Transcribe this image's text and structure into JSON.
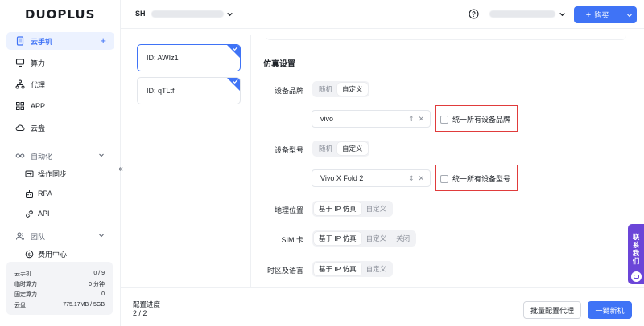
{
  "brand": {
    "logo_text": "DUOPLUS",
    "accent": "#3f73f6",
    "highlight_red": "#e03b3b",
    "contact_purple": "#6b45d8"
  },
  "sidebar": {
    "top_items": [
      {
        "label": "云手机",
        "icon": "phone-icon",
        "active": true
      },
      {
        "label": "算力",
        "icon": "monitor-icon"
      },
      {
        "label": "代理",
        "icon": "network-icon"
      },
      {
        "label": "APP",
        "icon": "apps-grid-icon"
      },
      {
        "label": "云盘",
        "icon": "cloud-icon"
      }
    ],
    "automation": {
      "label": "自动化",
      "items": [
        {
          "label": "操作同步",
          "icon": "sync-icon"
        },
        {
          "label": "RPA",
          "icon": "robot-icon"
        },
        {
          "label": "API",
          "icon": "link-icon"
        }
      ]
    },
    "team": {
      "label": "团队",
      "items": [
        {
          "label": "费用中心",
          "icon": "dollar-icon"
        }
      ]
    },
    "stats": [
      {
        "label": "云手机",
        "value": "0 / 9"
      },
      {
        "label": "临时算力",
        "value": "0 分钟"
      },
      {
        "label": "固定算力",
        "value": "0"
      },
      {
        "label": "云盘",
        "value": "775.17MB / 5GB"
      }
    ],
    "collapse_glyph": "«"
  },
  "header": {
    "region": "SH",
    "buy_label": "购买"
  },
  "devices": [
    {
      "id_label": "ID: AWIz1",
      "selected": true
    },
    {
      "id_label": "ID: qTLtf",
      "selected": false
    }
  ],
  "settings": {
    "section_title": "仿真设置",
    "brand": {
      "label": "设备品牌",
      "options": [
        "随机",
        "自定义"
      ],
      "selected": "自定义",
      "value": "vivo",
      "unify_label": "统一所有设备品牌"
    },
    "model": {
      "label": "设备型号",
      "options": [
        "随机",
        "自定义"
      ],
      "selected": "自定义",
      "value": "Vivo X Fold 2",
      "unify_label": "统一所有设备型号"
    },
    "location": {
      "label": "地理位置",
      "options": [
        "基于 IP 仿真",
        "自定义"
      ],
      "selected": "基于 IP 仿真"
    },
    "sim": {
      "label": "SIM 卡",
      "options": [
        "基于 IP 仿真",
        "自定义",
        "关闭"
      ],
      "selected": "基于 IP 仿真"
    },
    "timezone": {
      "label": "时区及语言",
      "options": [
        "基于 IP 仿真",
        "自定义"
      ],
      "selected": "基于 IP 仿真"
    }
  },
  "footer": {
    "progress_label": "配置进度",
    "progress_value": "2 / 2",
    "batch_proxy_label": "批量配置代理",
    "new_device_label": "一键新机"
  },
  "contact": {
    "label": "联系我们"
  }
}
